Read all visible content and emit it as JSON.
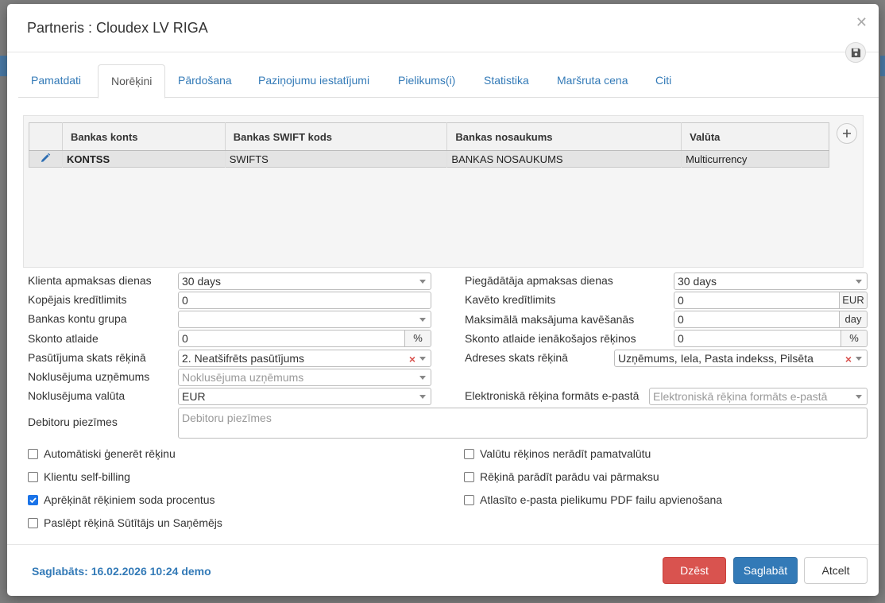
{
  "dialog": {
    "title": "Partneris : Cloudex LV RIGA"
  },
  "tabs": [
    "Pamatdati",
    "Norēķini",
    "Pārdošana",
    "Paziņojumu iestatījumi",
    "Pielikums(i)",
    "Statistika",
    "Maršruta cena",
    "Citi"
  ],
  "active_tab": "Norēķini",
  "bank_table": {
    "columns": [
      "Bankas konts",
      "Bankas SWIFT kods",
      "Bankas nosaukums",
      "Valūta"
    ],
    "rows": [
      {
        "account": "KONTSS",
        "swift": "SWIFTS",
        "bank_name": "BANKAS NOSAUKUMS",
        "currency": "Multicurrency"
      }
    ]
  },
  "form": {
    "client_payment_days": {
      "label": "Klienta apmaksas dienas",
      "value": "30 days"
    },
    "total_credit_limit": {
      "label": "Kopējais kredītlimits",
      "value": "0"
    },
    "bank_account_group": {
      "label": "Bankas kontu grupa",
      "value": ""
    },
    "discount": {
      "label": "Skonto atlaide",
      "value": "0",
      "unit": "%"
    },
    "order_view_invoice": {
      "label": "Pasūtījuma skats rēķinā",
      "value": "2. Neatšifrēts pasūtījums"
    },
    "default_company": {
      "label": "Noklusējuma uzņēmums",
      "placeholder": "Noklusējuma uzņēmums"
    },
    "default_currency": {
      "label": "Noklusējuma valūta",
      "value": "EUR"
    },
    "debtor_notes": {
      "label": "Debitoru piezīmes",
      "placeholder": "Debitoru piezīmes"
    },
    "supplier_payment_days": {
      "label": "Piegādātāja apmaksas dienas",
      "value": "30 days"
    },
    "overdue_credit_limit": {
      "label": "Kavēto kredītlimits",
      "value": "0",
      "unit": "EUR"
    },
    "max_payment_delay": {
      "label": "Maksimālā maksājuma kavēšanās",
      "value": "0",
      "unit": "day"
    },
    "incoming_discount": {
      "label": "Skonto atlaide ienākošajos rēķinos",
      "value": "0",
      "unit": "%"
    },
    "address_view_invoice": {
      "label": "Adreses skats rēķinā",
      "value": "Uzņēmums, Iela, Pasta indekss, Pilsēta"
    },
    "einvoice_format": {
      "label": "Elektroniskā rēķina formāts e-pastā",
      "placeholder": "Elektroniskā rēķina formāts e-pastā"
    }
  },
  "checkboxes": {
    "auto_generate": {
      "label": "Automātiski ģenerēt rēķinu",
      "checked": false
    },
    "self_billing": {
      "label": "Klientu self-billing",
      "checked": false
    },
    "penalty_interest": {
      "label": "Aprēķināt rēķiniem soda procentus",
      "checked": true
    },
    "hide_sender": {
      "label": "Paslēpt rēķinā Sūtītājs un Saņēmējs",
      "checked": false
    },
    "no_base_currency": {
      "label": "Valūtu rēķinos nerādīt pamatvalūtu",
      "checked": false
    },
    "show_debt": {
      "label": "Rēķinā parādīt parādu vai pārmaksu",
      "checked": false
    },
    "merge_pdf": {
      "label": "Atlasīto e-pasta pielikumu PDF failu apvienošana",
      "checked": false
    }
  },
  "footer": {
    "saved_info": "Saglabāts: 16.02.2026 10:24 demo",
    "delete_label": "Dzēst",
    "save_label": "Saglabāt",
    "cancel_label": "Atcelt"
  },
  "colors": {
    "primary": "#337ab7",
    "danger": "#d9534f",
    "checkbox_checked": "#1a73e8"
  }
}
